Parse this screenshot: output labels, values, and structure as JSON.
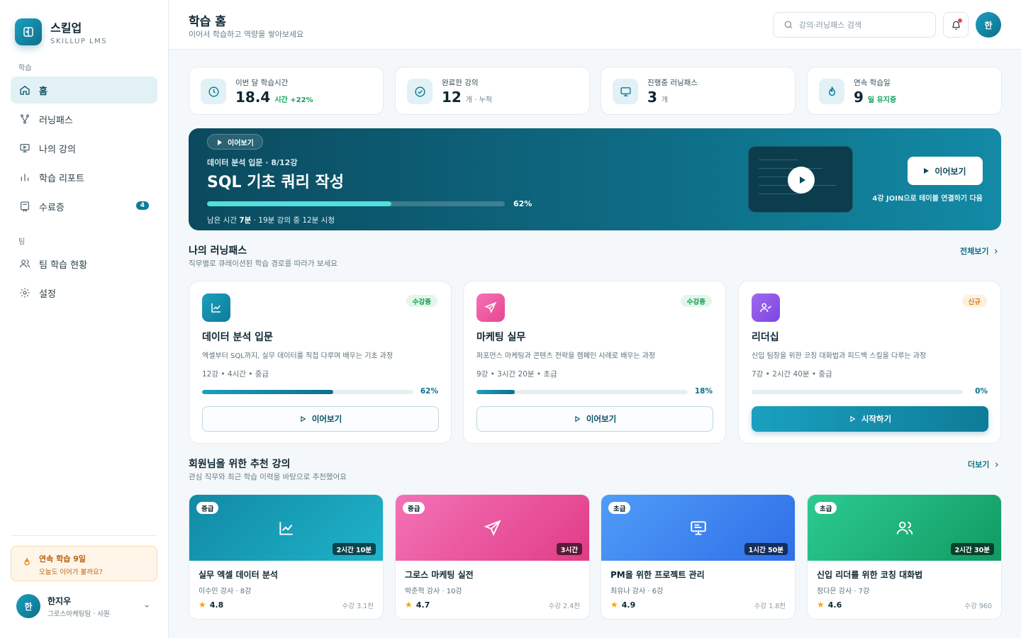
{
  "brand": {
    "name": "스킬업",
    "sub": "SKILLUP LMS"
  },
  "sidebar": {
    "section_learning": "학습",
    "section_team": "팀",
    "items": [
      {
        "label": "홈",
        "icon": "home-icon"
      },
      {
        "label": "러닝패스",
        "icon": "route-icon"
      },
      {
        "label": "나의 강의",
        "icon": "monitor-icon"
      },
      {
        "label": "학습 리포트",
        "icon": "bar-chart-icon"
      },
      {
        "label": "수료증",
        "icon": "certificate-icon",
        "badge": "4"
      },
      {
        "label": "팀 학습 현황",
        "icon": "users-icon"
      },
      {
        "label": "설정",
        "icon": "gear-icon"
      }
    ],
    "streak": {
      "title": "연속 학습 9일",
      "sub": "오늘도 이어가 볼까요?"
    },
    "user": {
      "initial": "한",
      "name": "한지우",
      "team": "그로스마케팅팀 · 사원"
    }
  },
  "header": {
    "title": "학습 홈",
    "sub": "이어서 학습하고 역량을 쌓아보세요",
    "search_placeholder": "강의·러닝패스 검색",
    "avatar_initial": "한"
  },
  "stats": [
    {
      "label": "이번 달 학습시간",
      "value": "18.4",
      "unit": "시간 +22%",
      "unit_green": true,
      "icon": "clock-icon"
    },
    {
      "label": "완료한 강의",
      "value": "12",
      "unit": "개 · 누적",
      "unit_green": false,
      "icon": "check-circle-icon"
    },
    {
      "label": "진행중 러닝패스",
      "value": "3",
      "unit": "개",
      "unit_green": false,
      "icon": "monitor-icon"
    },
    {
      "label": "연속 학습일",
      "value": "9",
      "unit": "일 유지중",
      "unit_green": true,
      "icon": "flame-icon"
    }
  ],
  "hero": {
    "chip": "이어보기",
    "meta": "데이터 분석 입문 · 8/12강",
    "title": "SQL 기초 쿼리 작성",
    "progress": 62,
    "progress_label": "62%",
    "remain_prefix": "남은 시간 ",
    "remain_bold": "7분",
    "remain_suffix": " · 19분 강의 중 12분 시청",
    "cta": "이어보기",
    "next": "4강 JOIN으로 테이블 연결하기 다음"
  },
  "learning_paths": {
    "title": "나의 러닝패스",
    "sub": "직무별로 큐레이션된 학습 경로를 따라가 보세요",
    "link": "전체보기",
    "cards": [
      {
        "title": "데이터 분석 입문",
        "desc": "엑셀부터 SQL까지, 실무 데이터를 직접 다루며 배우는 기초 과정",
        "meta": "12강  •  4시간  •  중급",
        "badge": "수강중",
        "badge_type": "on",
        "progress": 62,
        "pct": "62%",
        "button": "이어보기",
        "primary": false,
        "icon": "line-chart-icon",
        "color": "#1596b3"
      },
      {
        "title": "마케팅 실무",
        "desc": "퍼포먼스 마케팅과 콘텐츠 전략을 캠페인 사례로 배우는 과정",
        "meta": "9강  •  3시간 20분  •  초급",
        "badge": "수강중",
        "badge_type": "on",
        "progress": 18,
        "pct": "18%",
        "button": "이어보기",
        "primary": false,
        "icon": "send-icon",
        "color": "#e8468f"
      },
      {
        "title": "리더십",
        "desc": "신입 팀장을 위한 코칭 대화법과 피드백 스킬을 다루는 과정",
        "meta": "7강  •  2시간 40분  •  중급",
        "badge": "신규",
        "badge_type": "new",
        "progress": 0,
        "pct": "0%",
        "button": "시작하기",
        "primary": true,
        "icon": "user-check-icon",
        "color": "#8b55e6"
      }
    ]
  },
  "recommend": {
    "title": "회원님을 위한 추천 강의",
    "sub": "관심 직무와 최근 학습 이력을 바탕으로 추천했어요",
    "link": "더보기",
    "cards": [
      {
        "level": "중급",
        "duration": "2시간 10분",
        "title": "실무 엑셀 데이터 분석",
        "sub": "이수민 강사 · 8강",
        "rating": "4.8",
        "count": "수강 3.1천",
        "icon": "line-chart-icon",
        "from": "#128aa6",
        "to": "#1eb3c9"
      },
      {
        "level": "중급",
        "duration": "3시간",
        "title": "그로스 마케팅 실전",
        "sub": "박준혁 강사 · 10강",
        "rating": "4.7",
        "count": "수강 2.4천",
        "icon": "send-icon",
        "from": "#e8468f",
        "to": "#f472b6"
      },
      {
        "level": "초급",
        "duration": "1시간 50분",
        "title": "PM을 위한 프로젝트 관리",
        "sub": "최유나 강사 · 6강",
        "rating": "4.9",
        "count": "수강 1.8천",
        "icon": "presentation-icon",
        "from": "#3b82f6",
        "to": "#4f9cf7"
      },
      {
        "level": "초급",
        "duration": "2시간 30분",
        "title": "신입 리더를 위한 코칭 대화법",
        "sub": "정다은 강사 · 7강",
        "rating": "4.6",
        "count": "수강 960",
        "icon": "users-icon",
        "from": "#22c08a",
        "to": "#12a36c"
      }
    ]
  },
  "colors": {
    "accent": "#0e7c98",
    "accent_dark": "#0b4a5e",
    "green": "#11a05b",
    "orange": "#d97a13"
  }
}
